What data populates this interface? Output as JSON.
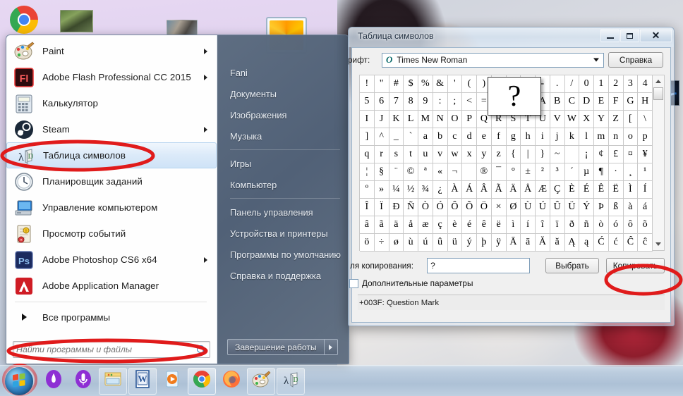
{
  "start_menu": {
    "programs": [
      {
        "label": "Paint",
        "icon": "paint-palette-icon",
        "has_submenu": true,
        "selected": false
      },
      {
        "label": "Adobe Flash Professional CC 2015",
        "icon": "adobe-flash-icon",
        "has_submenu": true,
        "selected": false
      },
      {
        "label": "Калькулятор",
        "icon": "calculator-icon",
        "has_submenu": false,
        "selected": false
      },
      {
        "label": "Steam",
        "icon": "steam-icon",
        "has_submenu": true,
        "selected": false
      },
      {
        "label": "Таблица символов",
        "icon": "character-map-icon",
        "has_submenu": false,
        "selected": true
      },
      {
        "label": "Планировщик заданий",
        "icon": "task-scheduler-clock-icon",
        "has_submenu": false,
        "selected": false
      },
      {
        "label": "Управление компьютером",
        "icon": "computer-management-icon",
        "has_submenu": false,
        "selected": false
      },
      {
        "label": "Просмотр событий",
        "icon": "event-viewer-icon",
        "has_submenu": false,
        "selected": false
      },
      {
        "label": "Adobe Photoshop CS6 x64",
        "icon": "photoshop-icon",
        "has_submenu": true,
        "selected": false
      },
      {
        "label": "Adobe Application Manager",
        "icon": "adobe-manager-icon",
        "has_submenu": false,
        "selected": false
      }
    ],
    "all_programs_label": "Все программы",
    "search": {
      "value": "",
      "placeholder": "Найти программы и файлы"
    },
    "right_panel": {
      "user_name": "Fani",
      "items": [
        "Документы",
        "Изображения",
        "Музыка",
        "Игры",
        "Компьютер",
        "Панель управления",
        "Устройства и принтеры",
        "Программы по умолчанию",
        "Справка и поддержка"
      ],
      "shutdown_label": "Завершение работы"
    }
  },
  "charmap": {
    "title": "Таблица символов",
    "window_buttons": {
      "minimize": "minimize-icon",
      "maximize": "maximize-icon",
      "close": "✕"
    },
    "font_label": "рифт:",
    "font_value": "Times New Roman",
    "help_label": "Справка",
    "magnified_char": "?",
    "grid_columns": 20,
    "grid_chars": [
      "!",
      "\"",
      "#",
      "$",
      "%",
      "&",
      "'",
      "(",
      ")",
      "*",
      "+",
      ",",
      "-",
      ".",
      "/",
      "0",
      "1",
      "2",
      "3",
      "4",
      "5",
      "6",
      "7",
      "8",
      "9",
      ":",
      ";",
      "<",
      "=",
      ">",
      "?",
      "@",
      "A",
      "B",
      "C",
      "D",
      "E",
      "F",
      "G",
      "H",
      "I",
      "J",
      "K",
      "L",
      "M",
      "N",
      "O",
      "P",
      "Q",
      "R",
      "S",
      "T",
      "U",
      "V",
      "W",
      "X",
      "Y",
      "Z",
      "[",
      "\\",
      "]",
      "^",
      "_",
      "`",
      "a",
      "b",
      "c",
      "d",
      "e",
      "f",
      "g",
      "h",
      "i",
      "j",
      "k",
      "l",
      "m",
      "n",
      "o",
      "p",
      "q",
      "r",
      "s",
      "t",
      "u",
      "v",
      "w",
      "x",
      "y",
      "z",
      "{",
      "|",
      "}",
      "~",
      " ",
      "¡",
      "¢",
      "£",
      "¤",
      "¥",
      "¦",
      "§",
      "¨",
      "©",
      "ª",
      "«",
      "¬",
      "­",
      "®",
      "¯",
      "°",
      "±",
      "²",
      "³",
      "´",
      "µ",
      "¶",
      "·",
      "¸",
      "¹",
      "º",
      "»",
      "¼",
      "½",
      "¾",
      "¿",
      "À",
      "Á",
      "Â",
      "Ã",
      "Ä",
      "Å",
      "Æ",
      "Ç",
      "È",
      "É",
      "Ê",
      "Ë",
      "Ì",
      "Í",
      "Î",
      "Ï",
      "Ð",
      "Ñ",
      "Ò",
      "Ó",
      "Ô",
      "Õ",
      "Ö",
      "×",
      "Ø",
      "Ù",
      "Ú",
      "Û",
      "Ü",
      "Ý",
      "Þ",
      "ß",
      "à",
      "á",
      "â",
      "ã",
      "ä",
      "å",
      "æ",
      "ç",
      "è",
      "é",
      "ê",
      "ë",
      "ì",
      "í",
      "î",
      "ï",
      "ð",
      "ñ",
      "ò",
      "ó",
      "ô",
      "õ",
      "ö",
      "÷",
      "ø",
      "ù",
      "ú",
      "û",
      "ü",
      "ý",
      "þ",
      "ÿ",
      "Ā",
      "ā",
      "Ă",
      "ă",
      "Ą",
      "ą",
      "Ć",
      "ć",
      "Ĉ",
      "ĉ"
    ],
    "copy_label": "ля копирования:",
    "copy_value": "?",
    "select_button": "Выбрать",
    "copy_button": "Копировать",
    "advanced_label": "Дополнительные параметры",
    "advanced_checked": false,
    "status_text": "+003F: Question Mark"
  },
  "taskbar": {
    "start_orb": "windows-orb-icon",
    "items": [
      {
        "icon": "purple-drop-icon",
        "framed": false
      },
      {
        "icon": "microphone-icon",
        "framed": false
      },
      {
        "icon": "explorer-folder-icon",
        "framed": true
      },
      {
        "icon": "word-icon",
        "framed": true
      },
      {
        "icon": "media-player-icon",
        "framed": false
      },
      {
        "icon": "chrome-icon",
        "framed": true,
        "active": true
      },
      {
        "icon": "firefox-icon",
        "framed": false
      },
      {
        "icon": "paint-icon",
        "framed": true
      },
      {
        "icon": "character-map-icon",
        "framed": true
      }
    ]
  },
  "desktop": {
    "icons": [
      {
        "name": "chrome-shortcut-icon"
      },
      {
        "name": "photo-thumbnail-icon"
      },
      {
        "name": "text-document-icon"
      },
      {
        "name": "photo-thumbnail-2-icon"
      },
      {
        "name": "flower-picture-icon"
      },
      {
        "name": "folder-icon"
      },
      {
        "name": "game-shortcut-icon"
      }
    ]
  },
  "annotations": {
    "accent_color": "#e01b1b",
    "ellipses": [
      {
        "name": "highlight-character-map-menu-item"
      },
      {
        "name": "highlight-search-box"
      },
      {
        "name": "highlight-copy-button"
      },
      {
        "name": "highlight-start-orb"
      }
    ]
  }
}
